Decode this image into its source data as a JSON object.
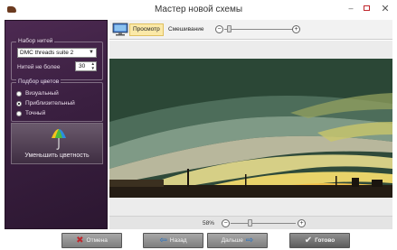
{
  "window": {
    "title": "Мастер новой схемы",
    "minimize": "–",
    "close": "✕"
  },
  "threads": {
    "legend": "Набор нитей",
    "selected": "DMC threads suite 2",
    "max_label": "Нитей не более",
    "max_value": "30"
  },
  "color_pick": {
    "legend": "Подбор цветов",
    "options": [
      {
        "label": "Визуальный",
        "selected": false
      },
      {
        "label": "Приблизительный",
        "selected": true
      },
      {
        "label": "Точный",
        "selected": false
      }
    ]
  },
  "reduce_button": {
    "label": "Уменьшить цветность"
  },
  "toolbar": {
    "preview": "Просмотр",
    "blend_label": "Смешивание",
    "minus": "−",
    "plus": "+"
  },
  "status": {
    "zoom": "58%",
    "minus": "−",
    "plus": "+"
  },
  "buttons": {
    "cancel": "Отмена",
    "back": "Назад",
    "next": "Дальше",
    "done": "Готово"
  },
  "colors": {
    "accent_cancel": "#c0272d",
    "accent_nav": "#1f6fc4",
    "panel": "#3a1f40"
  }
}
